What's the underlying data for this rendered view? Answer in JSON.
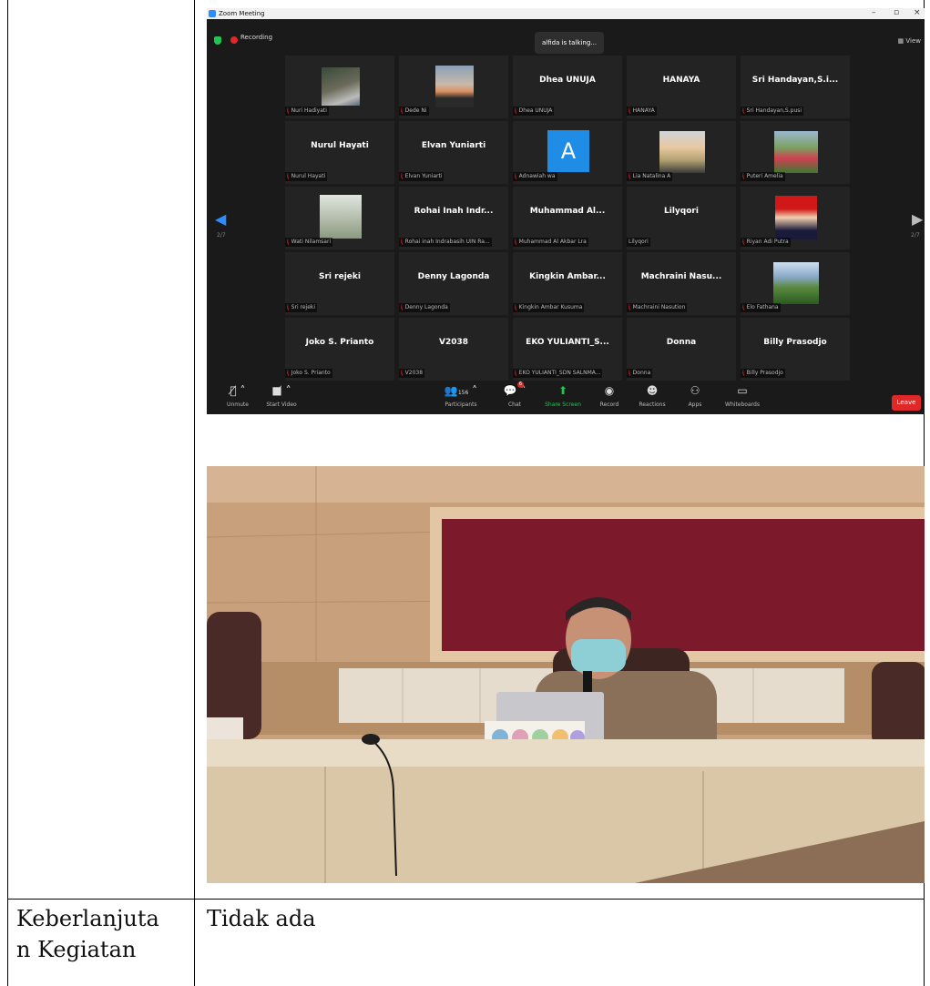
{
  "zoom": {
    "window_title": "Zoom Meeting",
    "recording_label": "Recording",
    "talking_banner": "alfida is talking...",
    "view_label": "View",
    "page_left": "2/7",
    "page_right": "2/7",
    "tiles": [
      {
        "display": "",
        "label": "Nuri Hadiyati"
      },
      {
        "display": "",
        "label": "Dede Ni"
      },
      {
        "display": "Dhea UNUJA",
        "label": "Dhea UNUJA"
      },
      {
        "display": "HANAYA",
        "label": "HANAYA"
      },
      {
        "display": "Sri Handayan,S.i...",
        "label": "Sri Handayan,S.pusi"
      },
      {
        "display": "Nurul Hayati",
        "label": "Nurul Hayati"
      },
      {
        "display": "Elvan Yuniarti",
        "label": "Elvan Yuniarti"
      },
      {
        "display": "A",
        "label": "Adnawiah wa"
      },
      {
        "display": "",
        "label": "Lia Natalina A"
      },
      {
        "display": "",
        "label": "Puteri Amelia"
      },
      {
        "display": "",
        "label": "Wati Nilamsari"
      },
      {
        "display": "Rohai Inah Indr...",
        "label": "Rohai inah Indrabasih UIN Ra..."
      },
      {
        "display": "Muhammad Al...",
        "label": "Muhammad Al Akbar Lra"
      },
      {
        "display": "Lilyqori",
        "label": "Lilyqori"
      },
      {
        "display": "",
        "label": "Riyan Adi Putra"
      },
      {
        "display": "Sri rejeki",
        "label": "Sri rejeki"
      },
      {
        "display": "Denny Lagonda",
        "label": "Denny Lagonda"
      },
      {
        "display": "Kingkin Ambar...",
        "label": "Kingkin Ambar Kusuma"
      },
      {
        "display": "Machraini Nasu...",
        "label": "Machraini Nasution"
      },
      {
        "display": "",
        "label": "Elo Fathana"
      },
      {
        "display": "Joko S. Prianto",
        "label": "Joko S. Prianto"
      },
      {
        "display": "V2038",
        "label": "V2038"
      },
      {
        "display": "EKO YULIANTI_S...",
        "label": "EKO YULIANTI_SDN SALNMA..."
      },
      {
        "display": "Donna",
        "label": "Donna"
      },
      {
        "display": "Billy Prasodjo",
        "label": "Billy Prasodjo"
      }
    ],
    "controls": {
      "unmute": "Unmute",
      "start_video": "Start Video",
      "participants": "Participants",
      "participants_count": "156",
      "chat": "Chat",
      "chat_badge": "6",
      "share_screen": "Share Screen",
      "record": "Record",
      "reactions": "Reactions",
      "apps": "Apps",
      "whiteboards": "Whiteboards",
      "leave": "Leave"
    }
  },
  "table": {
    "row_label": "Keberlanjutan Kegiatan",
    "row_label_line1": "Keberlanjuta",
    "row_label_line2": "n Kegiatan",
    "row_value": "Tidak ada"
  },
  "colors": {
    "zoom_bg": "#1a1a1a",
    "tile_bg": "#232323",
    "accent": "#2d8cff",
    "leave_red": "#e02828"
  }
}
